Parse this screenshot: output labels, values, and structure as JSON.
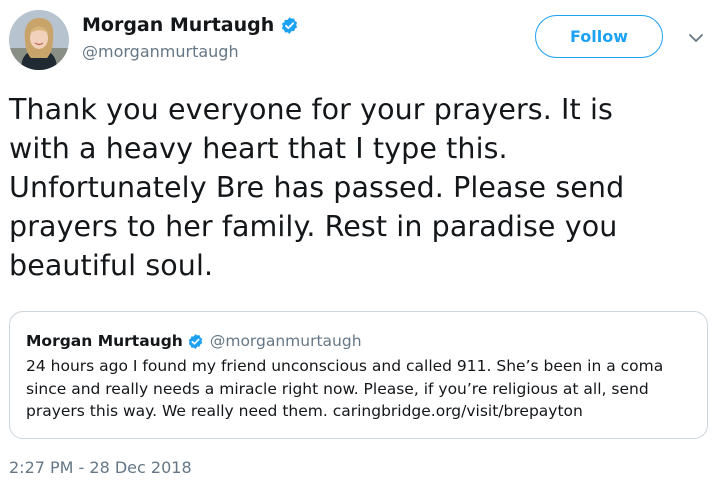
{
  "author": {
    "display_name": "Morgan Murtaugh",
    "handle": "@morganmurtaugh",
    "verified": true,
    "avatar_icon": "profile-photo"
  },
  "actions": {
    "follow_label": "Follow",
    "more_icon": "chevron-down-icon"
  },
  "tweet": {
    "text": "Thank you everyone for your prayers. It is\nwith a heavy heart that I type this.\nUnfortunately Bre has passed. Please send\nprayers to her family. Rest in paradise you\nbeautiful soul.",
    "timestamp": "2:27 PM - 28 Dec 2018"
  },
  "quoted_tweet": {
    "display_name": "Morgan Murtaugh",
    "handle": "@morganmurtaugh",
    "verified": true,
    "text": "24 hours ago I found my friend unconscious and called 911. She’s been in a coma\nsince and really needs a miracle right now. Please, if you’re religious at all, send\nprayers this way. We really need them. caringbridge.org/visit/brepayton"
  },
  "colors": {
    "accent": "#1da1f2",
    "text_primary": "#14171a",
    "text_secondary": "#657786",
    "border": "#ccd6dd"
  }
}
